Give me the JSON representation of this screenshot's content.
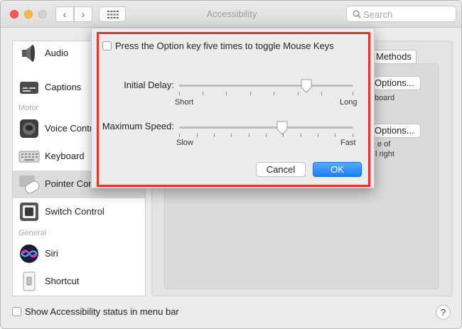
{
  "window": {
    "title": "Accessibility",
    "search_placeholder": "Search",
    "back_glyph": "‹",
    "forward_glyph": "›"
  },
  "sidebar": {
    "items": [
      {
        "label": "Audio",
        "icon": "speaker-icon"
      },
      {
        "label": "Captions",
        "icon": "captions-icon"
      },
      {
        "label": "Voice Control",
        "icon": "voice-control-icon"
      },
      {
        "label": "Keyboard",
        "icon": "keyboard-icon"
      },
      {
        "label": "Pointer Control",
        "icon": "pointer-control-icon",
        "selected": true
      },
      {
        "label": "Switch Control",
        "icon": "switch-control-icon"
      },
      {
        "label": "Siri",
        "icon": "siri-icon"
      },
      {
        "label": "Shortcut",
        "icon": "shortcut-icon"
      }
    ],
    "sections": {
      "motor": "Motor",
      "general": "General"
    }
  },
  "pane": {
    "methods_button": "Methods",
    "options_button_1": "Options...",
    "options_button_2": "Options...",
    "side_text_1": "board",
    "side_text_2": "e of",
    "side_text_3": "l right"
  },
  "dialog": {
    "checkbox_label": "Press the Option key five times to toggle Mouse Keys",
    "checkbox_checked": false,
    "initial_delay": {
      "label": "Initial Delay:",
      "min_label": "Short",
      "max_label": "Long",
      "value": 0.73
    },
    "maximum_speed": {
      "label": "Maximum Speed:",
      "min_label": "Slow",
      "max_label": "Fast",
      "value": 0.59
    },
    "cancel_label": "Cancel",
    "ok_label": "OK",
    "highlight_color": "#e8322b",
    "accent_color": "#1a7ef7"
  },
  "footer": {
    "status_checkbox_label": "Show Accessibility status in menu bar",
    "status_checkbox_checked": false,
    "help_label": "?"
  }
}
